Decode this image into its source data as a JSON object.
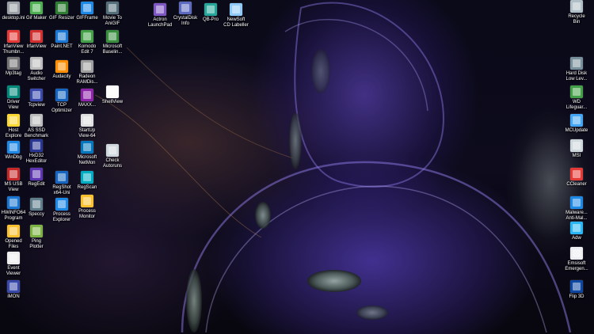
{
  "desktop": {
    "icons": [
      {
        "label": "desktop.ini",
        "icon": "ini-file-icon",
        "color": "#9aa0a6"
      },
      {
        "label": "Gif Maker",
        "icon": "gif-maker-icon",
        "color": "#4caf50"
      },
      {
        "label": "GIF Resizer",
        "icon": "gif-resizer-icon",
        "color": "#2e7d32"
      },
      {
        "label": "GIFFrame",
        "icon": "gifframe-icon",
        "color": "#1e88e5"
      },
      {
        "label": "Movie To\nAniGIF",
        "icon": "movie-to-anigif-icon",
        "color": "#546e7a"
      },
      {
        "label": "Actron\nLaunchPad",
        "icon": "actron-launchpad-icon",
        "color": "#7e57c2"
      },
      {
        "label": "CrystalDisk\nInfo",
        "icon": "crystaldisk-icon",
        "color": "#5c6bc0"
      },
      {
        "label": "QB-Pro",
        "icon": "qb-pro-icon",
        "color": "#26a69a"
      },
      {
        "label": "NewSoft\nCD Labeller",
        "icon": "cd-labeller-icon",
        "color": "#90caf9"
      },
      {
        "label": "Recycle\nBin",
        "icon": "recycle-bin-icon",
        "color": "#b0bec5"
      },
      {
        "label": "IrfanView\nThumbn...",
        "icon": "irfanview-thumb-icon",
        "color": "#e53935"
      },
      {
        "label": "IrfanView",
        "icon": "irfanview-icon",
        "color": "#d32f2f"
      },
      {
        "label": "Paint.NET",
        "icon": "paintnet-icon",
        "color": "#1976d2"
      },
      {
        "label": "Komodo\nEdit 7",
        "icon": "komodo-icon",
        "color": "#43a047"
      },
      {
        "label": "Microsoft\nBaselin...",
        "icon": "ms-baseline-icon",
        "color": "#388e3c"
      },
      {
        "label": "Mp3tag",
        "icon": "mp3tag-icon",
        "color": "#757575"
      },
      {
        "label": "Audio\nSwitcher",
        "icon": "audio-switcher-icon",
        "color": "#bdbdbd"
      },
      {
        "label": "Audacity",
        "icon": "audacity-icon",
        "color": "#ff8f00"
      },
      {
        "label": "Radeon\nRAMDis...",
        "icon": "radeon-ramdisk-icon",
        "color": "#9e9e9e"
      },
      {
        "label": "Hard Disk\nLow Lev...",
        "icon": "hard-disk-icon",
        "color": "#78909c"
      },
      {
        "label": "Driver\nView",
        "icon": "driverview-icon",
        "color": "#00897b"
      },
      {
        "label": "Tcpview",
        "icon": "tcpview-icon",
        "color": "#3949ab"
      },
      {
        "label": "TCP\nOptimizer",
        "icon": "tcp-optimizer-icon",
        "color": "#1565c0"
      },
      {
        "label": "MAXX...",
        "icon": "maxx-icon",
        "color": "#8e24aa"
      },
      {
        "label": "ShellView",
        "icon": "shellview-icon",
        "color": "#fafafa"
      },
      {
        "label": "WD\nLifeguar...",
        "icon": "wd-lifeguard-icon",
        "color": "#43a047"
      },
      {
        "label": "Host\nExplore",
        "icon": "host-explore-icon",
        "color": "#fdd835"
      },
      {
        "label": "AS SSD\nBenchmark",
        "icon": "as-ssd-icon",
        "color": "#bdbdbd"
      },
      {
        "label": "StartUp\nView-64",
        "icon": "startup-view-icon",
        "color": "#e0e0e0"
      },
      {
        "label": "MCUpdate",
        "icon": "mcupdate-icon",
        "color": "#42a5f5"
      },
      {
        "label": "WinDbg",
        "icon": "windbg-icon",
        "color": "#1e88e5"
      },
      {
        "label": "HxD32\nHexEditor",
        "icon": "hxd-icon",
        "color": "#283593"
      },
      {
        "label": "Microsoft\nNetMon",
        "icon": "netmon-icon",
        "color": "#0277bd"
      },
      {
        "label": "Check\nAutoruns",
        "icon": "autoruns-icon",
        "color": "#cfd8dc"
      },
      {
        "label": "MSI",
        "icon": "msi-icon",
        "color": "#cfd8dc"
      },
      {
        "label": "MS USB\nView",
        "icon": "usbview-icon",
        "color": "#c62828"
      },
      {
        "label": "RegEdit",
        "icon": "regedit-icon",
        "color": "#5e35b1"
      },
      {
        "label": "RegShot\nx64-Uni",
        "icon": "regshot-icon",
        "color": "#1565c0"
      },
      {
        "label": "RegScan",
        "icon": "regscan-icon",
        "color": "#00acc1"
      },
      {
        "label": "CCleaner",
        "icon": "ccleaner-icon",
        "color": "#e53935"
      },
      {
        "label": "HWiNFO64\nProgram",
        "icon": "hwinfo-icon",
        "color": "#1976d2"
      },
      {
        "label": "Speccy",
        "icon": "speccy-icon",
        "color": "#607d8b"
      },
      {
        "label": "Process\nExplorer",
        "icon": "process-explorer-icon",
        "color": "#1e88e5"
      },
      {
        "label": "Process\nMonitor",
        "icon": "process-monitor-icon",
        "color": "#fbc02d"
      },
      {
        "label": "Malware...\nAnti-Mal...",
        "icon": "malwarebytes-icon",
        "color": "#1e88e5"
      },
      {
        "label": "Opened\nFiles",
        "icon": "opened-files-icon",
        "color": "#fbc02d"
      },
      {
        "label": "Ping\nPlotter",
        "icon": "pingplotter-icon",
        "color": "#7cb342"
      },
      {
        "label": "Adw",
        "icon": "adwcleaner-icon",
        "color": "#29b6f6"
      },
      {
        "label": "Event\nViewer",
        "icon": "event-viewer-icon",
        "color": "#eeeeee"
      },
      {
        "label": "Emsisoft\nEmergen...",
        "icon": "emsisoft-icon",
        "color": "#eceff1"
      },
      {
        "label": "iMON",
        "icon": "imon-icon",
        "color": "#3949ab"
      },
      {
        "label": "Flip 3D",
        "icon": "flip3d-icon",
        "color": "#0d47a1"
      }
    ]
  }
}
